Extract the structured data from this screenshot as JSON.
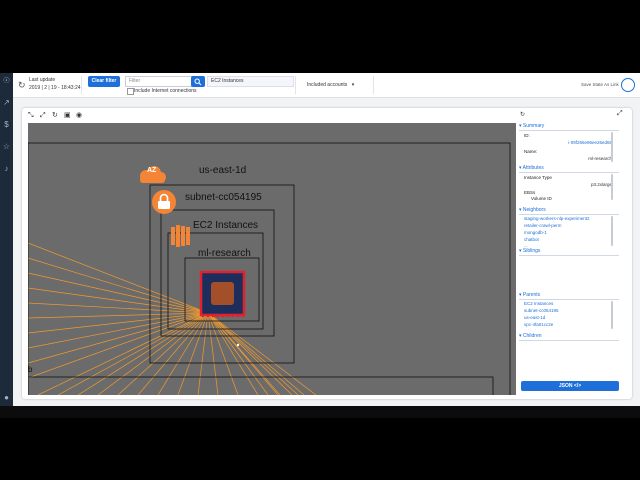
{
  "topbar": {
    "last_update_label": "Last update",
    "last_update_value": "2019 | 2 | 19 - 18:43:24",
    "clear_filter_label": "Clear filter",
    "filter_placeholder": "Filter",
    "active_filter_tag": "EC2 Instances",
    "include_internet_label": "Include Internet connections",
    "included_accounts_label": "Included accounts",
    "save_state_label": "Save State As Link"
  },
  "canvas": {
    "az_badge": "AZ",
    "availability_zone": "us-east-1d",
    "subnet": "subnet-cc054195",
    "group": "EC2 Instances",
    "instance": "ml-research",
    "partial_label": "b"
  },
  "details": {
    "summary_title": "Summary",
    "id_label": "ID:",
    "id_value": "i-09f266e96ee26ed68",
    "name_label": "Name:",
    "name_value": "ml-research",
    "attributes_title": "Attributes",
    "instance_type_label": "Instance Type",
    "instance_type_value": "p3.2xlarge",
    "ebs_label": "EBSs",
    "volume_id_label": "Volume ID",
    "neighbors_title": "Neighbors",
    "neighbors": [
      "staging-workers-nlp-experiment2",
      "retailer-crawl-perm",
      "mongodb-1",
      "chatbot",
      "..."
    ],
    "siblings_title": "Siblings",
    "parents_title": "Parents",
    "parents": [
      "EC2 Instances",
      "subnet-cc054195",
      "us-east-1d",
      "vpc-4fa01cc2e"
    ],
    "children_title": "Children",
    "json_button": "JSON </>"
  },
  "colors": {
    "accent": "#1e6fd9",
    "aws_orange": "#f58536",
    "node_red": "#e0222a",
    "node_navy": "#1d2e5c",
    "node_core": "#a3502a",
    "canvas_bg": "#6b6b6b",
    "nav_bg": "#1d2a3a"
  },
  "icons": [
    "refresh-icon",
    "search-icon",
    "checkbox-icon",
    "caret-down-icon",
    "share-link-icon",
    "lock-icon",
    "ec2-icon",
    "cloud-icon",
    "dollar-icon",
    "star-icon",
    "bell-icon"
  ]
}
